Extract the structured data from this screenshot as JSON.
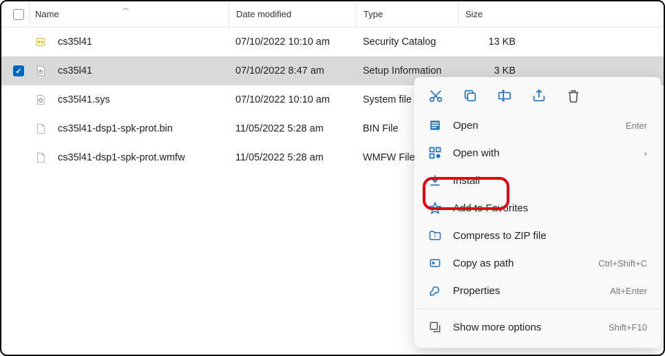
{
  "columns": {
    "name": "Name",
    "date": "Date modified",
    "type": "Type",
    "size": "Size"
  },
  "files": [
    {
      "name": "cs35l41",
      "date": "07/10/2022 10:10 am",
      "type": "Security Catalog",
      "size": "13 KB",
      "icon": "cat",
      "selected": false
    },
    {
      "name": "cs35l41",
      "date": "07/10/2022 8:47 am",
      "type": "Setup Information",
      "size": "3 KB",
      "icon": "inf",
      "selected": true
    },
    {
      "name": "cs35l41.sys",
      "date": "07/10/2022 10:10 am",
      "type": "System file",
      "size": "",
      "icon": "sys",
      "selected": false
    },
    {
      "name": "cs35l41-dsp1-spk-prot.bin",
      "date": "11/05/2022 5:28 am",
      "type": "BIN File",
      "size": "",
      "icon": "doc",
      "selected": false
    },
    {
      "name": "cs35l41-dsp1-spk-prot.wmfw",
      "date": "11/05/2022 5:28 am",
      "type": "WMFW File",
      "size": "",
      "icon": "doc",
      "selected": false
    }
  ],
  "context": {
    "open": "Open",
    "open_kb": "Enter",
    "openwith": "Open with",
    "install": "Install",
    "favorites": "Add to Favorites",
    "compress": "Compress to ZIP file",
    "copypath": "Copy as path",
    "copypath_kb": "Ctrl+Shift+C",
    "properties": "Properties",
    "properties_kb": "Alt+Enter",
    "more": "Show more options",
    "more_kb": "Shift+F10"
  }
}
